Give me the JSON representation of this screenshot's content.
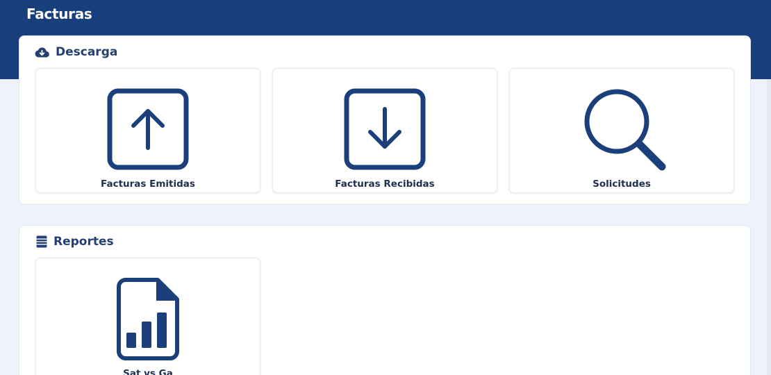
{
  "header": {
    "title": "Facturas"
  },
  "sections": {
    "download": {
      "title": "Descarga",
      "icon": "cloud-download-icon",
      "cards": [
        {
          "label": "Facturas Emitidas",
          "icon": "upload-arrow-box-icon"
        },
        {
          "label": "Facturas Recibidas",
          "icon": "download-arrow-box-icon"
        },
        {
          "label": "Solicitudes",
          "icon": "magnifier-icon"
        }
      ]
    },
    "reports": {
      "title": "Reportes",
      "icon": "list-table-icon",
      "cards": [
        {
          "label": "Sat vs Ga",
          "icon": "file-chart-icon"
        }
      ]
    }
  },
  "colors": {
    "primary": "#183e7c",
    "icon": "#1b3f7a",
    "background": "#eef3fb",
    "text_dark": "#1e2f52"
  }
}
